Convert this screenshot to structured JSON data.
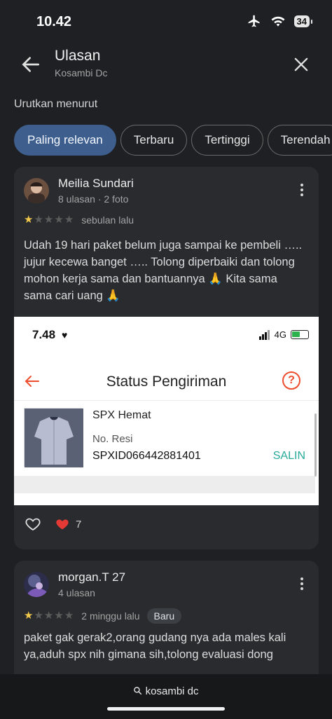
{
  "status_bar": {
    "time": "10.42",
    "battery": "34"
  },
  "header": {
    "title": "Ulasan",
    "subtitle": "Kosambi Dc"
  },
  "sort": {
    "label": "Urutkan menurut",
    "chips": [
      "Paling relevan",
      "Terbaru",
      "Tertinggi",
      "Terendah"
    ]
  },
  "reviews": [
    {
      "name": "Meilia Sundari",
      "meta": "8 ulasan · 2 foto",
      "rating": 1,
      "time": "sebulan lalu",
      "text": "Udah 19 hari paket belum juga sampai ke pembeli ….. jujur kecewa banget ….. Tolong diperbaiki dan tolong mohon kerja sama dan bantuannya 🙏 Kita sama sama cari uang 🙏",
      "likes": "7",
      "photo": {
        "time": "7.48",
        "heart": "♥",
        "network": "4G",
        "title": "Status Pengiriman",
        "help": "?",
        "service": "SPX Hemat",
        "resi_label": "No. Resi",
        "resi": "SPXID066442881401",
        "copy": "SALIN"
      }
    },
    {
      "name": "morgan.T 27",
      "meta": "4 ulasan",
      "rating": 1,
      "time": "2 minggu lalu",
      "badge": "Baru",
      "text": "paket gak gerak2,orang gudang nya ada males kali ya,aduh spx nih gimana sih,tolong evaluasi dong"
    }
  ],
  "bottom": {
    "url": "kosambi dc"
  },
  "colors": {
    "accent": "#3e5f8e",
    "star": "#f2c94c",
    "shopee": "#ee4d2d",
    "copy": "#26aa99"
  }
}
